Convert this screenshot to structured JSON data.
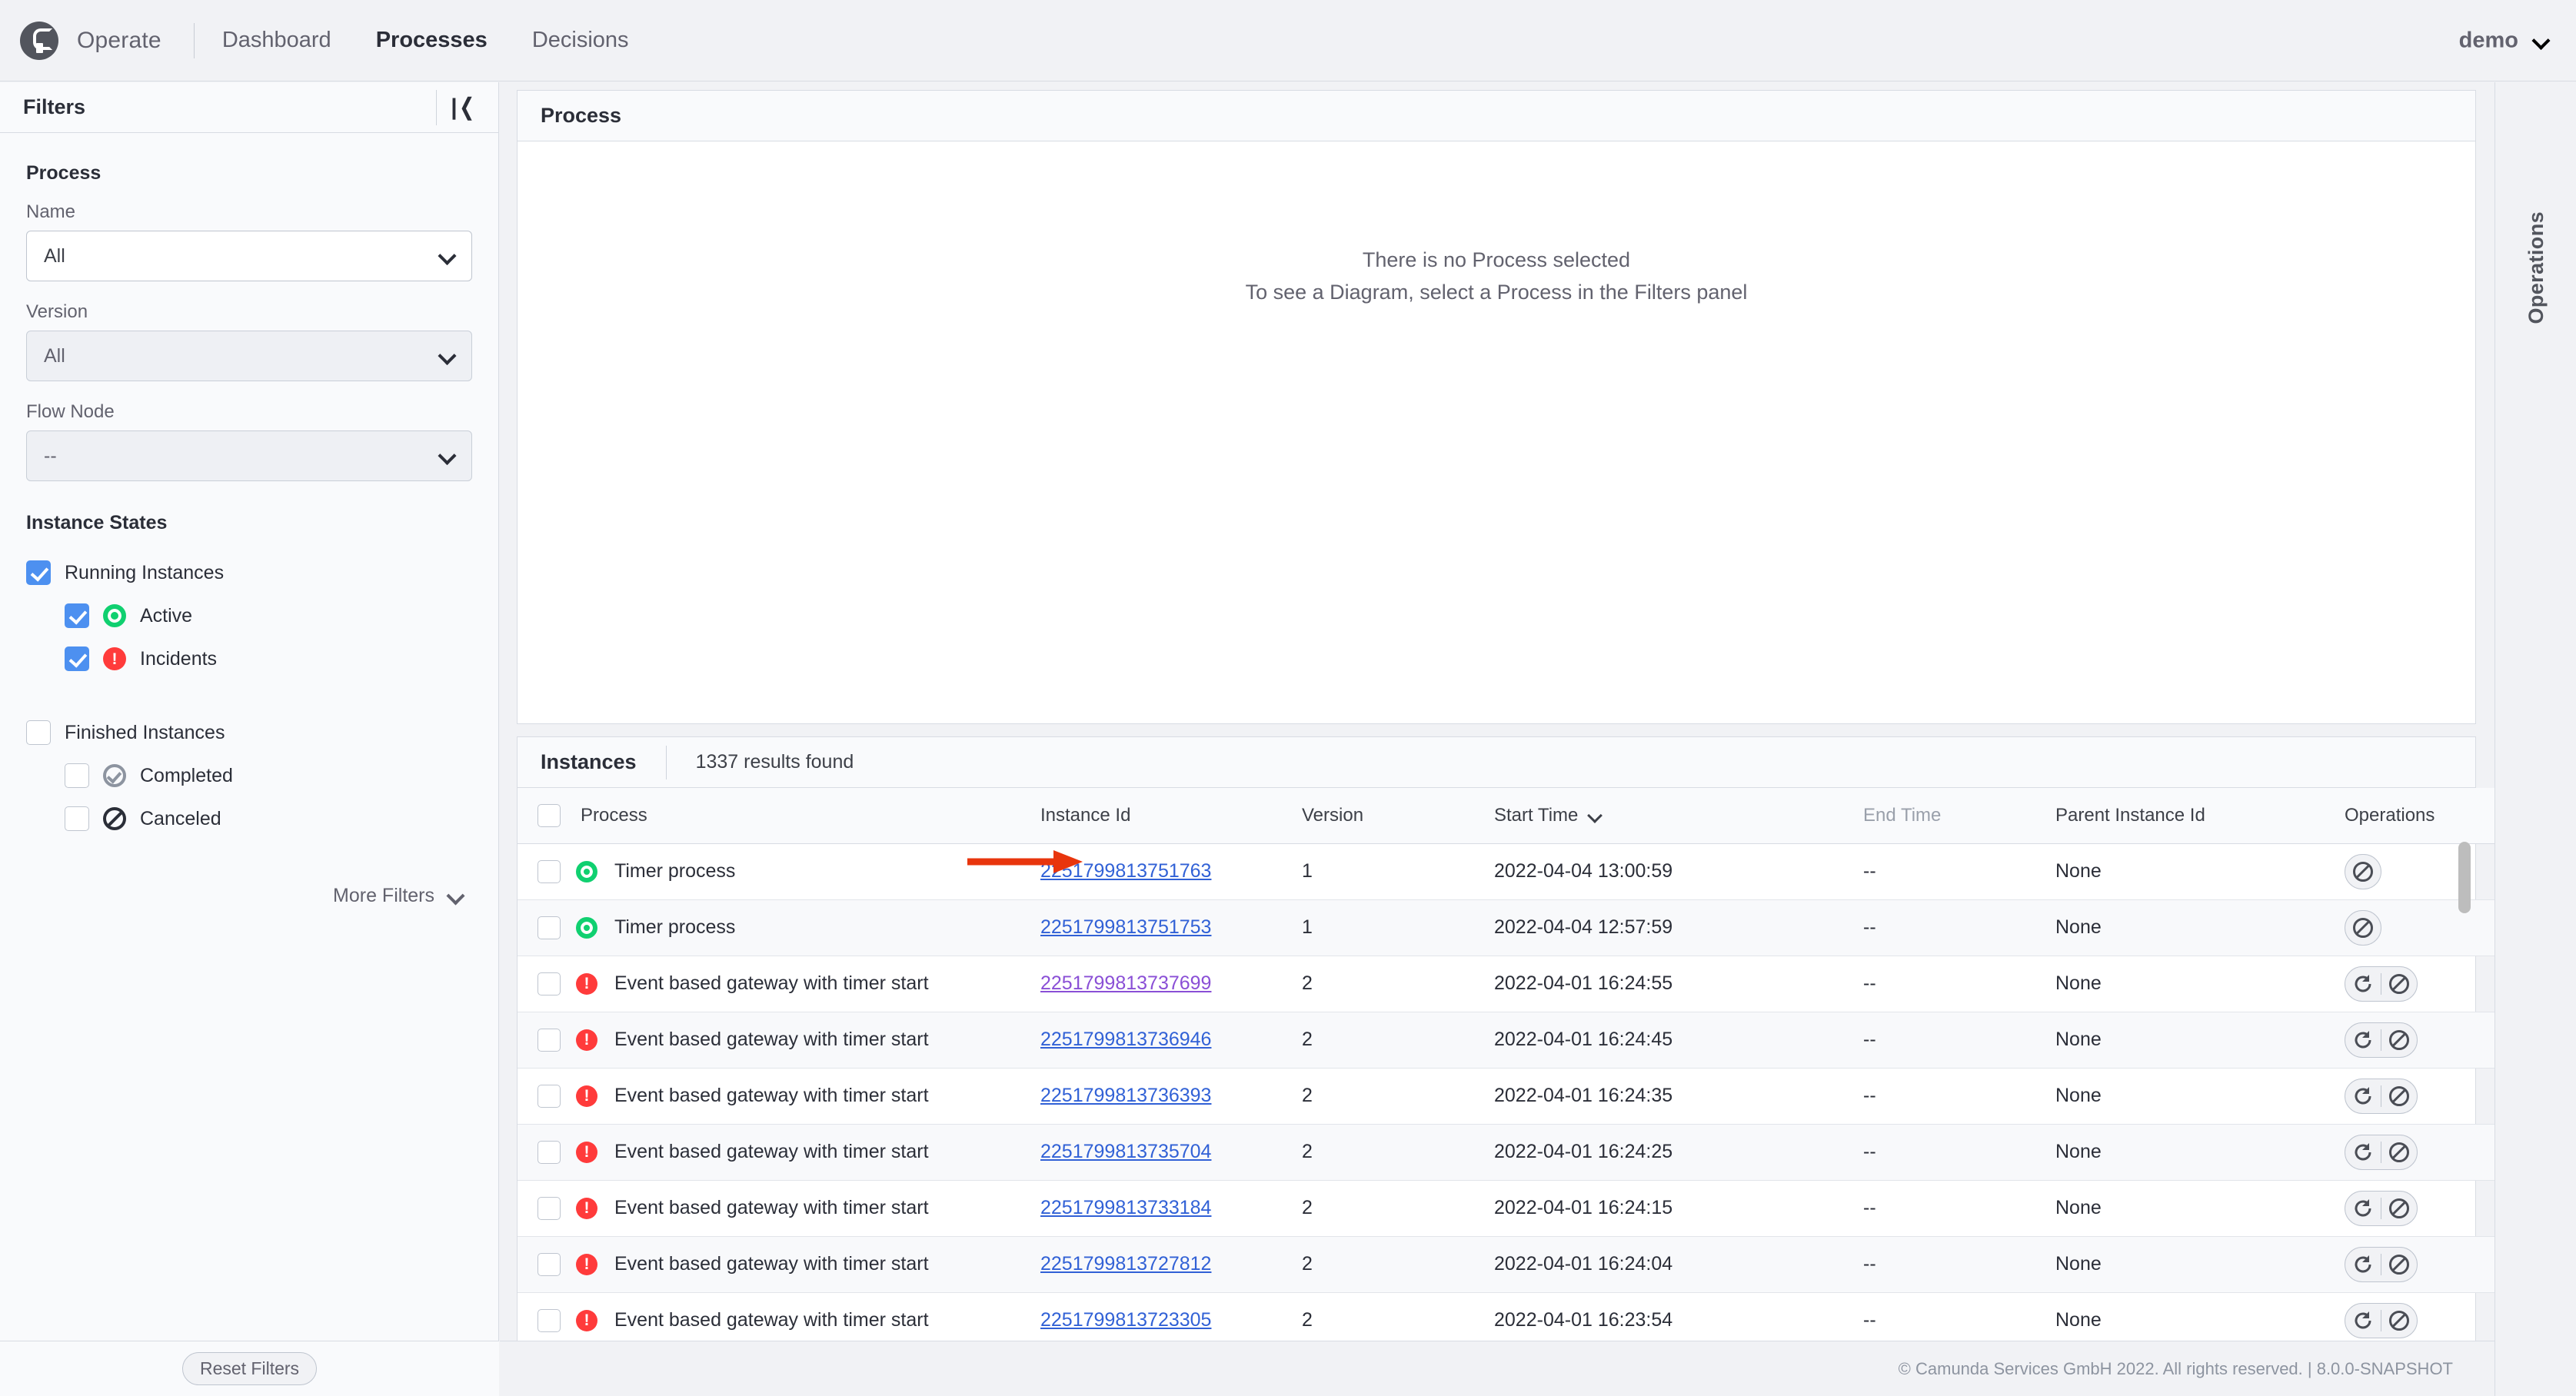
{
  "header": {
    "brand": "Operate",
    "logo_icon": "camunda-logo-icon",
    "nav": [
      {
        "label": "Dashboard",
        "active": false
      },
      {
        "label": "Processes",
        "active": true
      },
      {
        "label": "Decisions",
        "active": false
      }
    ],
    "user": "demo",
    "user_chevron_icon": "chevron-down-icon"
  },
  "filters": {
    "title": "Filters",
    "collapse_icon": "collapse-panel-icon",
    "collapse_glyph": "|❬",
    "process_section": "Process",
    "name_label": "Name",
    "name_value": "All",
    "version_label": "Version",
    "version_value": "All",
    "flownode_label": "Flow Node",
    "flownode_value": "--",
    "instance_states_title": "Instance States",
    "checkboxes": [
      {
        "label": "Running Instances",
        "checked": true,
        "indent": false,
        "icon": null
      },
      {
        "label": "Active",
        "checked": true,
        "indent": true,
        "icon": "active-state-icon"
      },
      {
        "label": "Incidents",
        "checked": true,
        "indent": true,
        "icon": "incident-state-icon"
      },
      {
        "label": "Finished Instances",
        "checked": false,
        "indent": false,
        "icon": null
      },
      {
        "label": "Completed",
        "checked": false,
        "indent": true,
        "icon": "completed-state-icon"
      },
      {
        "label": "Canceled",
        "checked": false,
        "indent": true,
        "icon": "canceled-state-icon"
      }
    ],
    "more_filters_label": "More Filters",
    "more_filters_icon": "chevron-down-icon",
    "reset_label": "Reset Filters"
  },
  "diagram": {
    "title": "Process",
    "empty_line1": "There is no Process selected",
    "empty_line2": "To see a Diagram, select a Process in the Filters panel"
  },
  "instances": {
    "title": "Instances",
    "results_count": "1337 results found",
    "columns": [
      {
        "label": "Process",
        "muted": false,
        "sorted": false
      },
      {
        "label": "Instance Id",
        "muted": false,
        "sorted": false
      },
      {
        "label": "Version",
        "muted": false,
        "sorted": false
      },
      {
        "label": "Start Time",
        "muted": false,
        "sorted": true
      },
      {
        "label": "End Time",
        "muted": true,
        "sorted": false
      },
      {
        "label": "Parent Instance Id",
        "muted": false,
        "sorted": false
      },
      {
        "label": "Operations",
        "muted": false,
        "sorted": false
      }
    ],
    "sort_icon": "chevron-down-icon",
    "rows": [
      {
        "state": "active",
        "process": "Timer process",
        "id": "2251799813751763",
        "visited": false,
        "version": "1",
        "start": "2022-04-04 13:00:59",
        "end": "--",
        "parent": "None",
        "ops": [
          "cancel"
        ]
      },
      {
        "state": "active",
        "process": "Timer process",
        "id": "2251799813751753",
        "visited": false,
        "version": "1",
        "start": "2022-04-04 12:57:59",
        "end": "--",
        "parent": "None",
        "ops": [
          "cancel"
        ]
      },
      {
        "state": "incident",
        "process": "Event based gateway with timer start",
        "id": "2251799813737699",
        "visited": true,
        "version": "2",
        "start": "2022-04-01 16:24:55",
        "end": "--",
        "parent": "None",
        "ops": [
          "retry",
          "cancel"
        ]
      },
      {
        "state": "incident",
        "process": "Event based gateway with timer start",
        "id": "2251799813736946",
        "visited": false,
        "version": "2",
        "start": "2022-04-01 16:24:45",
        "end": "--",
        "parent": "None",
        "ops": [
          "retry",
          "cancel"
        ]
      },
      {
        "state": "incident",
        "process": "Event based gateway with timer start",
        "id": "2251799813736393",
        "visited": false,
        "version": "2",
        "start": "2022-04-01 16:24:35",
        "end": "--",
        "parent": "None",
        "ops": [
          "retry",
          "cancel"
        ]
      },
      {
        "state": "incident",
        "process": "Event based gateway with timer start",
        "id": "2251799813735704",
        "visited": false,
        "version": "2",
        "start": "2022-04-01 16:24:25",
        "end": "--",
        "parent": "None",
        "ops": [
          "retry",
          "cancel"
        ]
      },
      {
        "state": "incident",
        "process": "Event based gateway with timer start",
        "id": "2251799813733184",
        "visited": false,
        "version": "2",
        "start": "2022-04-01 16:24:15",
        "end": "--",
        "parent": "None",
        "ops": [
          "retry",
          "cancel"
        ]
      },
      {
        "state": "incident",
        "process": "Event based gateway with timer start",
        "id": "2251799813727812",
        "visited": false,
        "version": "2",
        "start": "2022-04-01 16:24:04",
        "end": "--",
        "parent": "None",
        "ops": [
          "retry",
          "cancel"
        ]
      },
      {
        "state": "incident",
        "process": "Event based gateway with timer start",
        "id": "2251799813723305",
        "visited": false,
        "version": "2",
        "start": "2022-04-01 16:23:54",
        "end": "--",
        "parent": "None",
        "ops": [
          "retry",
          "cancel"
        ]
      }
    ]
  },
  "operations_rail": {
    "label": "Operations"
  },
  "footer": {
    "copyright": "© Camunda Services GmbH 2022. All rights reserved. | 8.0.0-SNAPSHOT"
  },
  "annotation": {
    "arrow_color": "#e8350d",
    "arrow_icon": "pointer-arrow-icon"
  },
  "colors": {
    "accent_blue": "#4d90f0",
    "link_blue": "#3161d6",
    "link_visited": "#8a4fd6",
    "active_green": "#10d070",
    "incident_red": "#ff3b3b",
    "annotation_red": "#e8350d"
  }
}
